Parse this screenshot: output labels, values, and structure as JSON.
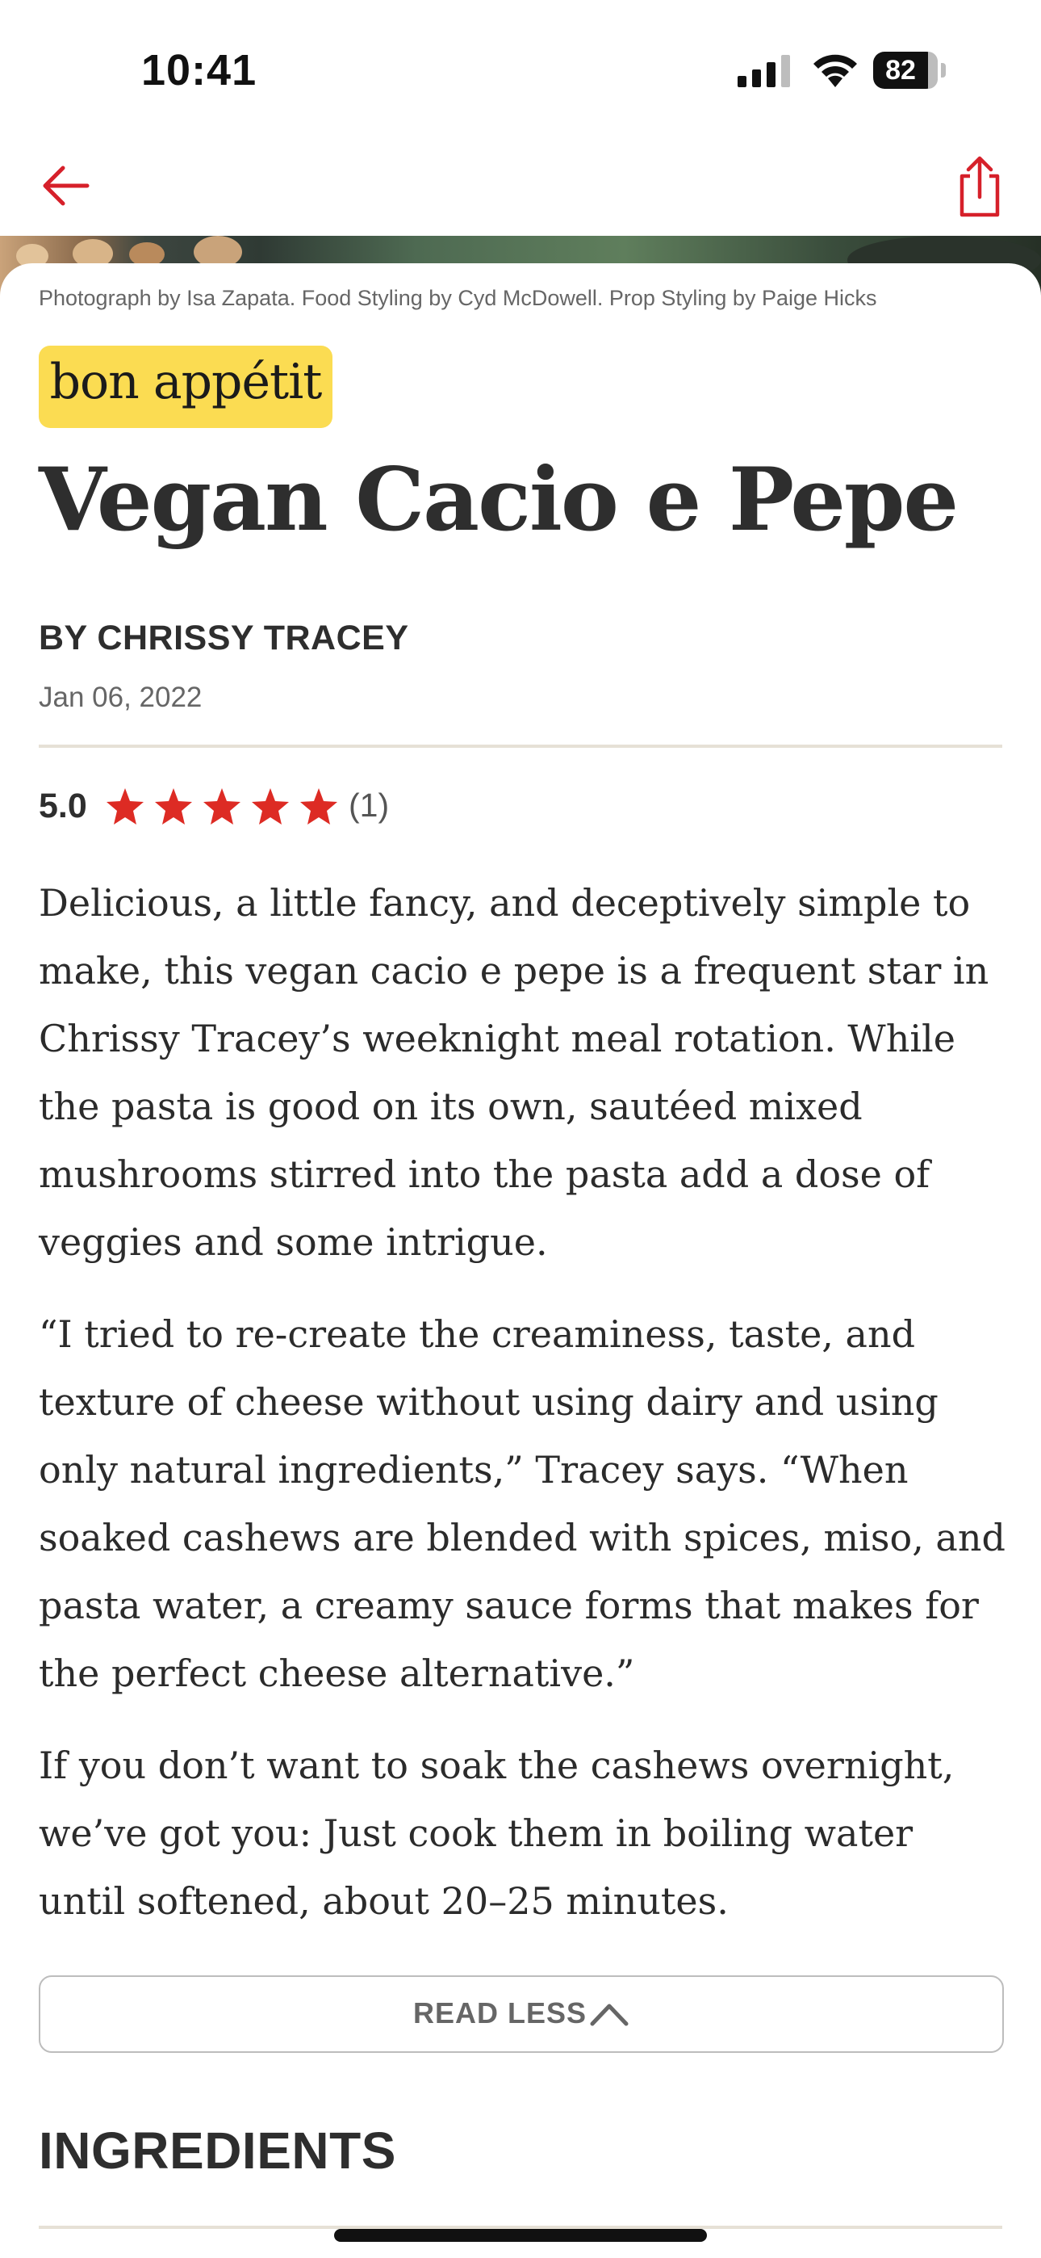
{
  "status_bar": {
    "time": "10:41",
    "battery": "82"
  },
  "nav": {
    "back_icon": "arrow-left-icon",
    "share_icon": "share-icon",
    "accent_color": "#d6202a"
  },
  "article": {
    "photo_credit": "Photograph by Isa Zapata. Food Styling by Cyd McDowell. Prop Styling by Paige Hicks",
    "brand": "bon appétit",
    "brand_color": "#fbdc52",
    "title": "Vegan Cacio e Pepe",
    "byline": "BY CHRISSY TRACEY",
    "date": "Jan 06, 2022",
    "rating": {
      "value": "5.0",
      "stars": 5,
      "count": "(1)",
      "star_color": "#dd2b24"
    },
    "paragraphs": [
      "Delicious, a little fancy, and deceptively simple to make, this vegan cacio e pepe is a frequent star in Chrissy Tracey’s weeknight meal rotation. While the pasta is good on its own, sautéed mixed mushrooms stirred into the pasta add a dose of veggies and some intrigue.",
      "“I tried to re-create the creaminess, taste, and texture of cheese without using dairy and using only natural ingredients,” Tracey says. “When soaked cashews are blended with spices, miso, and pasta water, a creamy sauce forms that makes for the perfect cheese alternative.”",
      "If you don’t want to soak the cashews overnight, we’ve got you: Just cook them in boiling water until softened, about 20–25 minutes."
    ],
    "read_less_label": "READ LESS",
    "ingredients_heading": "INGREDIENTS"
  }
}
